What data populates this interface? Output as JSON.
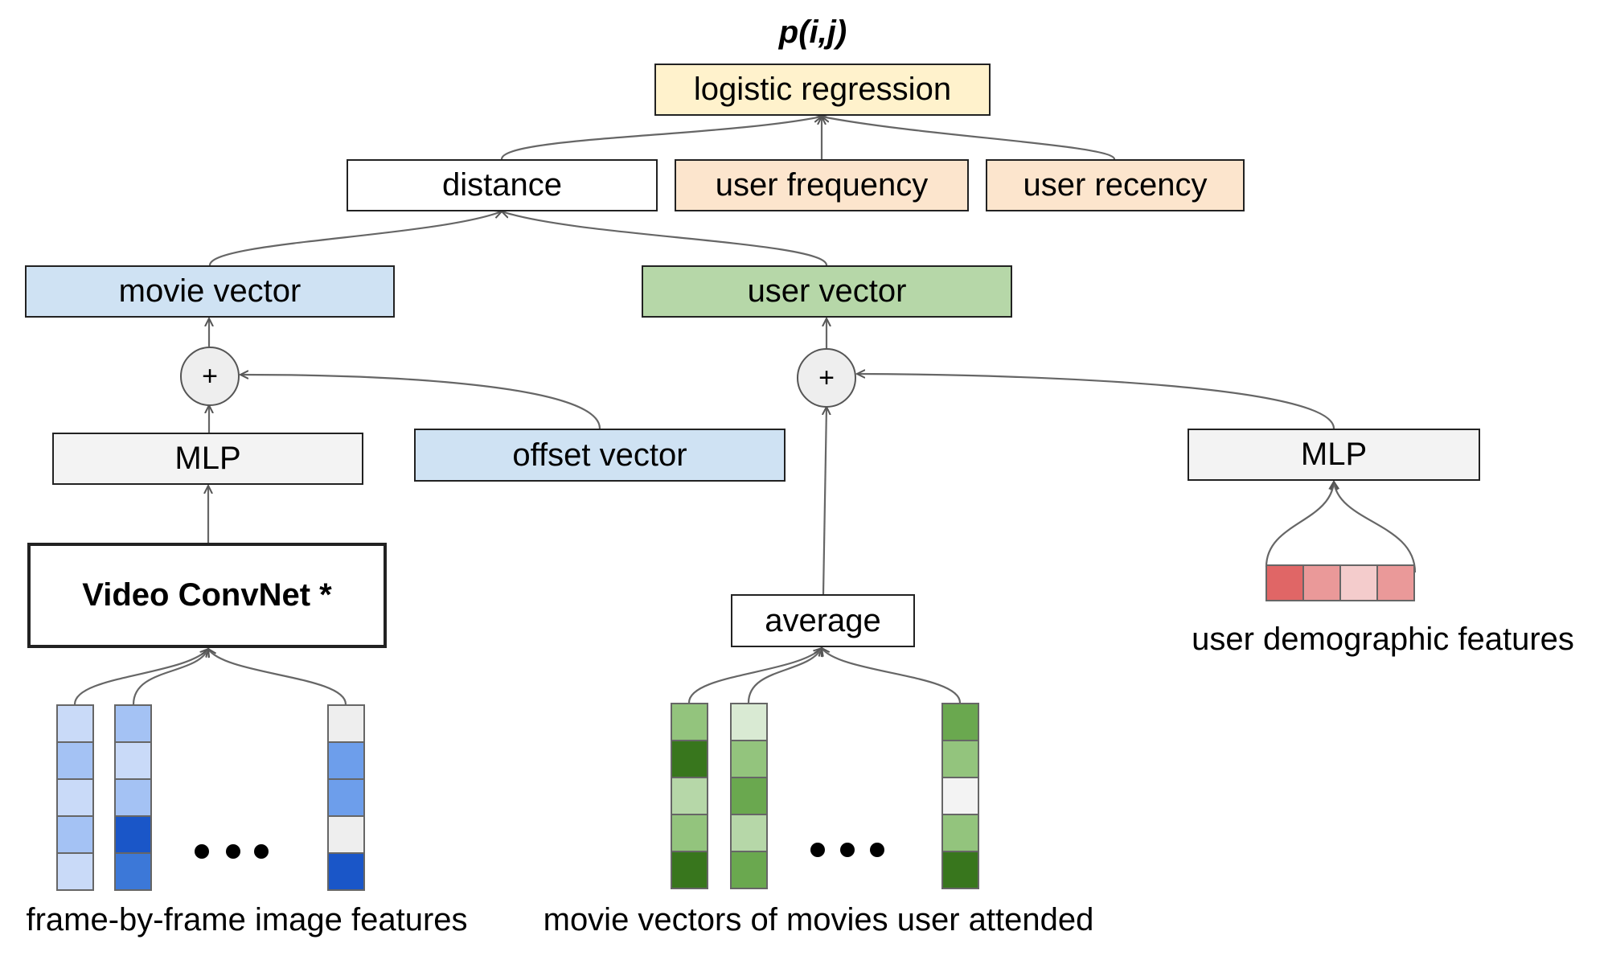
{
  "output_label": "p(i,j)",
  "nodes": {
    "logistic_regression": {
      "label": "logistic regression",
      "color": "#fff2cc"
    },
    "distance": {
      "label": "distance",
      "color": "#ffffff"
    },
    "user_frequency": {
      "label": "user frequency",
      "color": "#fce5cd"
    },
    "user_recency": {
      "label": "user recency",
      "color": "#fce5cd"
    },
    "movie_vector": {
      "label": "movie vector",
      "color": "#cfe2f3"
    },
    "user_vector": {
      "label": "user vector",
      "color": "#b6d7a8"
    },
    "plus_left": {
      "label": "+"
    },
    "plus_right": {
      "label": "+"
    },
    "mlp_left": {
      "label": "MLP",
      "color": "#f3f3f3"
    },
    "offset_vector": {
      "label": "offset vector",
      "color": "#cfe2f3"
    },
    "mlp_right": {
      "label": "MLP",
      "color": "#f3f3f3"
    },
    "video_convnet": {
      "label": "Video ConvNet *",
      "color": "#ffffff"
    },
    "average": {
      "label": "average",
      "color": "#ffffff"
    }
  },
  "inputs": {
    "frame_features": {
      "label": "frame-by-frame image features",
      "columns": [
        [
          "#c9daf8",
          "#a4c2f4",
          "#c9daf8",
          "#a4c2f4",
          "#c9daf8"
        ],
        [
          "#a4c2f4",
          "#c9daf8",
          "#a4c2f4",
          "#1a56c8",
          "#3c78d8"
        ],
        [
          "#eeeeee",
          "#6d9eeb",
          "#6d9eeb",
          "#eeeeee",
          "#1a56c8"
        ]
      ]
    },
    "movie_vectors": {
      "label": "movie vectors of movies user attended",
      "columns": [
        [
          "#93c47d",
          "#38761d",
          "#b6d7a8",
          "#93c47d",
          "#38761d"
        ],
        [
          "#d9ead3",
          "#93c47d",
          "#6aa84f",
          "#b6d7a8",
          "#6aa84f"
        ],
        [
          "#6aa84f",
          "#93c47d",
          "#f3f3f3",
          "#93c47d",
          "#38761d"
        ]
      ]
    },
    "demographic_features": {
      "label": "user demographic features",
      "cells": [
        "#e06666",
        "#ea9999",
        "#f4cccc",
        "#ea9999"
      ]
    }
  },
  "edges": [
    [
      "distance",
      "logistic_regression"
    ],
    [
      "user_frequency",
      "logistic_regression"
    ],
    [
      "user_recency",
      "logistic_regression"
    ],
    [
      "movie_vector",
      "distance"
    ],
    [
      "user_vector",
      "distance"
    ],
    [
      "plus_left",
      "movie_vector"
    ],
    [
      "mlp_left",
      "plus_left"
    ],
    [
      "offset_vector",
      "plus_left"
    ],
    [
      "video_convnet",
      "mlp_left"
    ],
    [
      "frame_features",
      "video_convnet"
    ],
    [
      "plus_right",
      "user_vector"
    ],
    [
      "average",
      "plus_right"
    ],
    [
      "mlp_right",
      "plus_right"
    ],
    [
      "movie_vectors",
      "average"
    ],
    [
      "demographic_features",
      "mlp_right"
    ]
  ]
}
